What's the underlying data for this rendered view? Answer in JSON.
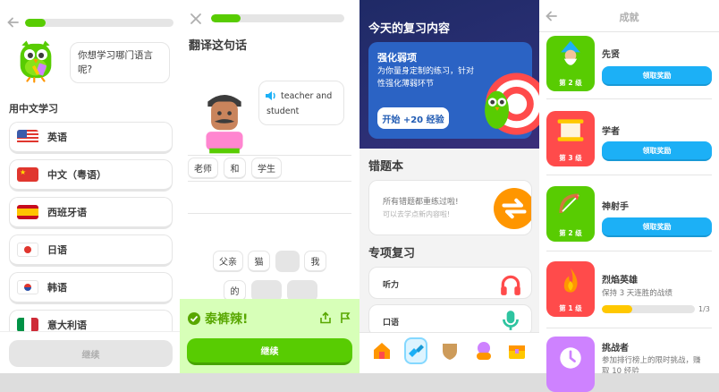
{
  "panel1": {
    "progress_fraction": 0.14,
    "prompt": "你想学习哪门语言呢?",
    "section_label": "用中文学习",
    "languages": [
      {
        "label": "英语",
        "flag": "us"
      },
      {
        "label": "中文（粤语）",
        "flag": "cn"
      },
      {
        "label": "西班牙语",
        "flag": "es"
      },
      {
        "label": "日语",
        "flag": "jp"
      },
      {
        "label": "韩语",
        "flag": "kr"
      },
      {
        "label": "意大利语",
        "flag": "it"
      }
    ],
    "continue_label": "继续"
  },
  "panel2": {
    "progress_fraction": 0.22,
    "title": "翻译这句话",
    "speech": "teacher and student",
    "answer_words": [
      "老师",
      "和",
      "学生"
    ],
    "bank_words": [
      "父亲",
      "猫",
      "",
      "我",
      "的",
      "",
      ""
    ],
    "feedback": "泰裤辣!",
    "continue_label": "继续"
  },
  "panel3": {
    "hero_title": "今天的复习内容",
    "card_title": "强化弱项",
    "card_desc": "为你量身定制的练习，针对性强化薄弱环节",
    "start_label": "开始 +20 经验",
    "mistakes_title": "错题本",
    "mistakes_text": "所有错题都重练过啦!",
    "mistakes_sub": "可以去学点新内容啦!",
    "practice_title": "专项复习",
    "practice_items": [
      "听力",
      "口语"
    ],
    "tabs": [
      "home-icon",
      "practice-icon",
      "shield-icon",
      "character-icon",
      "chest-icon"
    ]
  },
  "panel4": {
    "title": "成就",
    "achievements": [
      {
        "name": "先贤",
        "level": "第 2 级",
        "button": "领取奖励",
        "color": "#58cc02"
      },
      {
        "name": "学者",
        "level": "第 3 级",
        "button": "领取奖励",
        "color": "#ff4b4b"
      },
      {
        "name": "神射手",
        "level": "第 2 级",
        "button": "领取奖励",
        "color": "#58cc02"
      },
      {
        "name": "烈焰英雄",
        "level": "第 1 级",
        "desc": "保持 3 天连胜的战绩",
        "progress_text": "1/3",
        "progress_fraction": 0.33,
        "color": "#ff4b4b"
      },
      {
        "name": "挑战者",
        "desc": "参加排行榜上的限时挑战，赚取 10 经验",
        "color": "#ce82ff"
      }
    ]
  },
  "colors": {
    "green": "#58cc02",
    "blue": "#1cb0f6",
    "red": "#ff4b4b",
    "navy": "#1f2a66"
  }
}
